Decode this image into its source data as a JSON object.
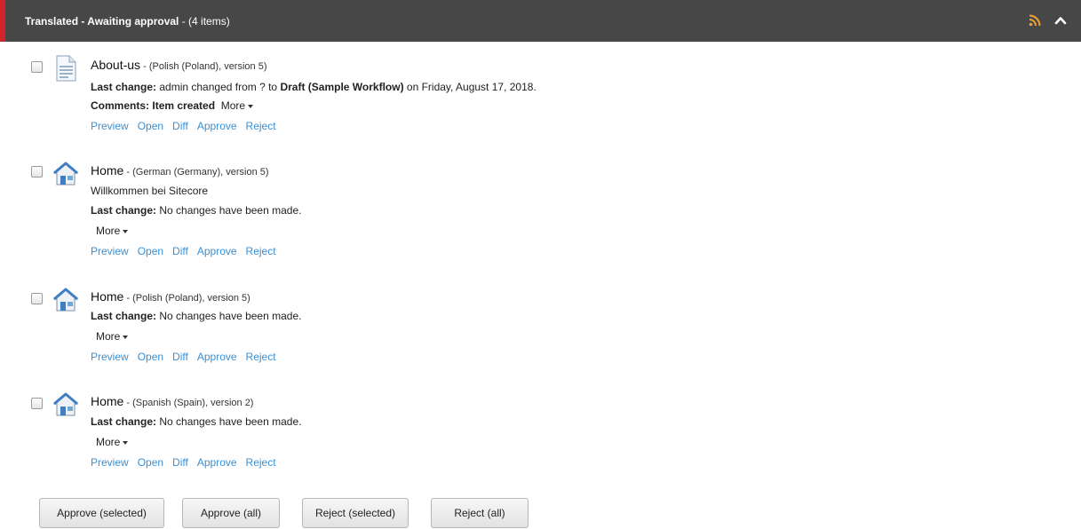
{
  "header": {
    "title": "Translated - Awaiting approval",
    "count": " - (4 items)",
    "bg_color": "#474747",
    "accent_color": "#d2232a",
    "rss_color": "#f0a030"
  },
  "items": [
    {
      "name": "About-us",
      "meta": " - (Polish (Poland), version 5)",
      "icon": "document-icon",
      "last_change_label": "Last change:",
      "last_change_text_1": " admin changed from ? to ",
      "last_change_bold": "Draft (Sample Workflow)",
      "last_change_text_2": " on Friday, August 17, 2018.",
      "comments_label": "Comments:",
      "comments_value": "Item created",
      "more": "More",
      "actions": [
        "Preview",
        "Open",
        "Diff",
        "Approve",
        "Reject"
      ]
    },
    {
      "name": "Home",
      "meta": " - (German (Germany), version 5)",
      "icon": "home-icon",
      "subtitle": "Willkommen bei Sitecore",
      "last_change_label": "Last change:",
      "last_change_text": " No changes have been made.",
      "more": "More",
      "actions": [
        "Preview",
        "Open",
        "Diff",
        "Approve",
        "Reject"
      ]
    },
    {
      "name": "Home",
      "meta": " - (Polish (Poland), version 5)",
      "icon": "home-icon",
      "last_change_label": "Last change:",
      "last_change_text": " No changes have been made.",
      "more": "More",
      "actions": [
        "Preview",
        "Open",
        "Diff",
        "Approve",
        "Reject"
      ]
    },
    {
      "name": "Home",
      "meta": " - (Spanish (Spain), version 2)",
      "icon": "home-icon",
      "last_change_label": "Last change:",
      "last_change_text": " No changes have been made.",
      "more": "More",
      "actions": [
        "Preview",
        "Open",
        "Diff",
        "Approve",
        "Reject"
      ]
    }
  ],
  "buttons": {
    "approve_selected": "Approve (selected)",
    "approve_all": "Approve (all)",
    "reject_selected": "Reject (selected)",
    "reject_all": "Reject (all)"
  },
  "colors": {
    "link": "#3b8fd2"
  }
}
